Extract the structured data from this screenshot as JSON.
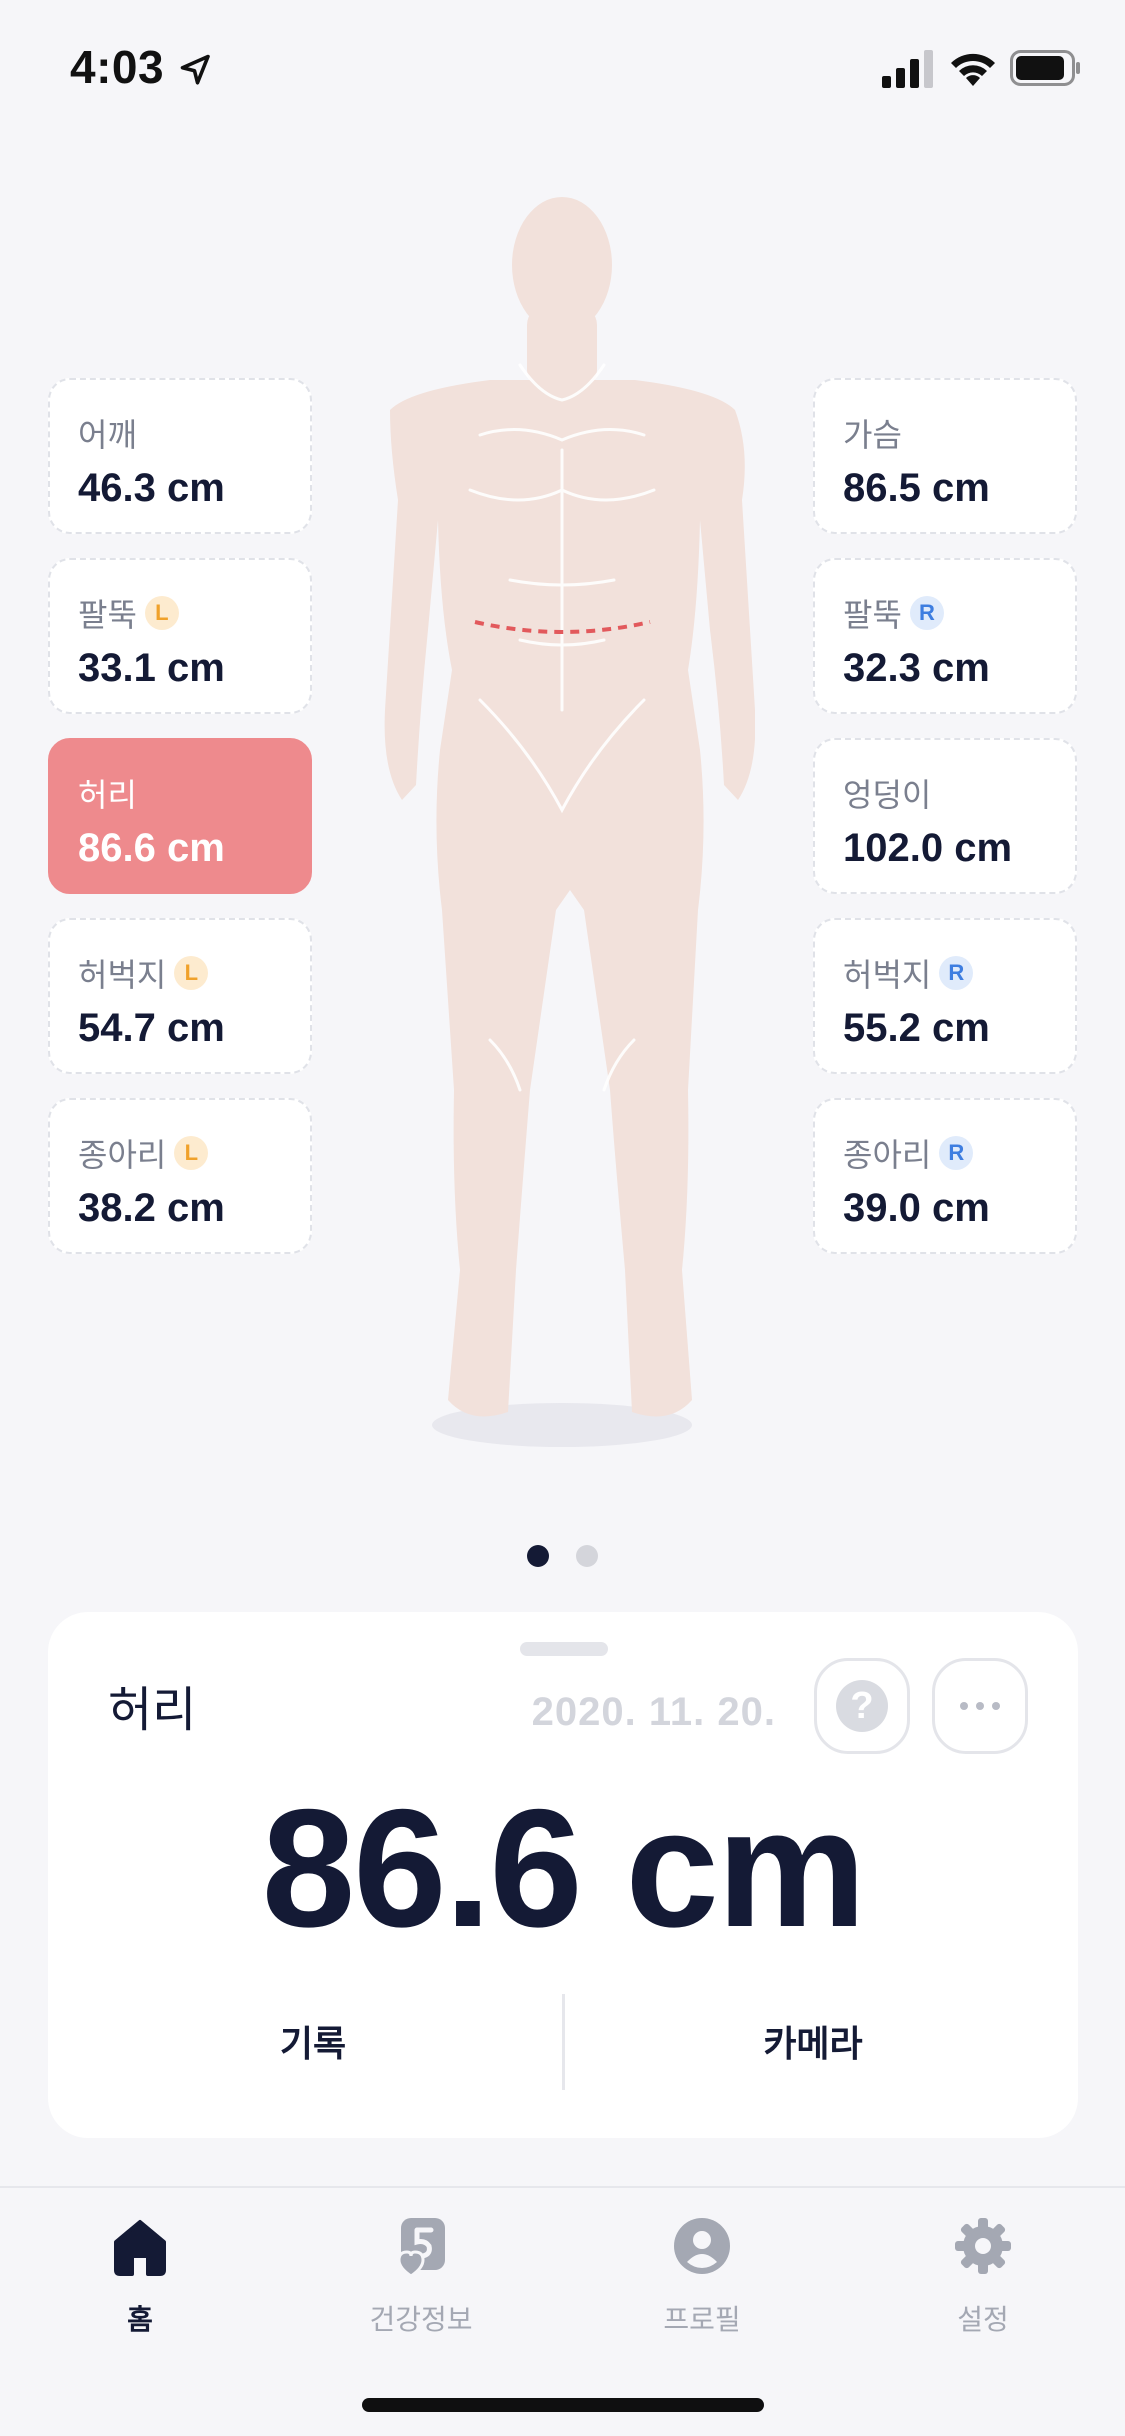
{
  "status_bar": {
    "time": "4:03"
  },
  "measurements_left": [
    {
      "label": "어깨",
      "value": "46.3 cm",
      "badge": "",
      "active": false
    },
    {
      "label": "팔뚝",
      "value": "33.1 cm",
      "badge": "L",
      "active": false
    },
    {
      "label": "허리",
      "value": "86.6 cm",
      "badge": "",
      "active": true
    },
    {
      "label": "허벅지",
      "value": "54.7 cm",
      "badge": "L",
      "active": false
    },
    {
      "label": "종아리",
      "value": "38.2 cm",
      "badge": "L",
      "active": false
    }
  ],
  "measurements_right": [
    {
      "label": "가슴",
      "value": "86.5 cm",
      "badge": "",
      "active": false
    },
    {
      "label": "팔뚝",
      "value": "32.3 cm",
      "badge": "R",
      "active": false
    },
    {
      "label": "엉덩이",
      "value": "102.0 cm",
      "badge": "",
      "active": false
    },
    {
      "label": "허벅지",
      "value": "55.2 cm",
      "badge": "R",
      "active": false
    },
    {
      "label": "종아리",
      "value": "39.0 cm",
      "badge": "R",
      "active": false
    }
  ],
  "pager": {
    "pages": 2,
    "current": 1
  },
  "detail": {
    "title": "허리",
    "date": "2020. 11. 20.",
    "value": "86.6 cm",
    "help_icon": "question-icon",
    "more_icon": "more-dots-icon",
    "record_label": "기록",
    "camera_label": "카메라"
  },
  "tabs": [
    {
      "label": "홈",
      "icon": "home-icon",
      "active": true
    },
    {
      "label": "건강정보",
      "icon": "health-info-icon",
      "active": false
    },
    {
      "label": "프로필",
      "icon": "profile-icon",
      "active": false
    },
    {
      "label": "설정",
      "icon": "gear-icon",
      "active": false
    }
  ],
  "colors": {
    "accent": "#ee8a8d",
    "text_primary": "#141a35",
    "badge_left": "#f0a12a",
    "badge_right": "#3e7ee0",
    "background": "#f6f6f9"
  }
}
